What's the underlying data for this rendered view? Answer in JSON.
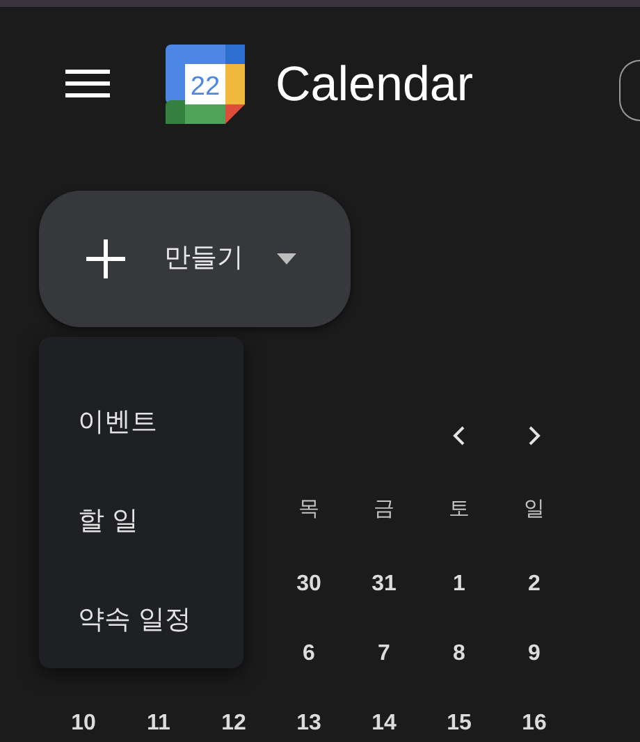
{
  "header": {
    "title": "Calendar",
    "logo_day": "22"
  },
  "create_button": {
    "label": "만들기"
  },
  "create_menu": {
    "items": [
      {
        "label": "이벤트"
      },
      {
        "label": "할 일"
      },
      {
        "label": "약속 일정"
      }
    ]
  },
  "mini_calendar": {
    "weekdays": [
      "목",
      "금",
      "토",
      "일"
    ],
    "weeks": [
      [
        "30",
        "31",
        "1",
        "2"
      ],
      [
        "6",
        "7",
        "8",
        "9"
      ],
      [
        "10",
        "11",
        "12",
        "13",
        "14",
        "15",
        "16"
      ]
    ]
  }
}
